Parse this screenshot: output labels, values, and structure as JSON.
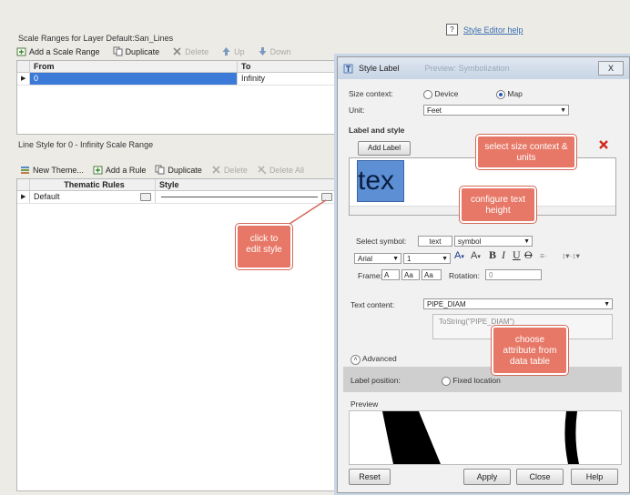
{
  "help_link": "Style Editor help",
  "scale_ranges": {
    "title": "Scale Ranges for Layer Default:San_Lines",
    "toolbar": {
      "add": "Add a Scale Range",
      "duplicate": "Duplicate",
      "delete": "Delete",
      "up": "Up",
      "down": "Down"
    },
    "columns": [
      "From",
      "To"
    ],
    "rows": [
      {
        "from": "0",
        "to": "Infinity"
      }
    ]
  },
  "line_style": {
    "title": "Line Style for 0 - Infinity Scale Range",
    "toolbar": {
      "new_theme": "New Theme...",
      "add_rule": "Add a Rule",
      "duplicate": "Duplicate",
      "delete": "Delete",
      "delete_all": "Delete All"
    },
    "columns": [
      "Thematic Rules",
      "Style"
    ],
    "rows": [
      {
        "rule": "Default",
        "style": ""
      }
    ]
  },
  "dialog": {
    "title": "Style Label",
    "title_hint": "Preview: Symbolization",
    "close": "X",
    "size_context_label": "Size context:",
    "device_label": "Device",
    "map_label": "Map",
    "unit_label": "Unit:",
    "unit_value": "Feet",
    "label_and_style": "Label and style",
    "add_label": "Add Label",
    "preview_text": "tex",
    "select_symbol_label": "Select symbol:",
    "symbol_text": "text",
    "symbol_value": "symbol",
    "font_value": "Arial",
    "size_value": "1",
    "bold": "B",
    "italic": "I",
    "underline": "U",
    "strike": "O",
    "frame_label": "Frame:",
    "frame_a": "A",
    "frame_aa": "Aa",
    "frame_box": "Aa",
    "rotation_label": "Rotation:",
    "rotation_value": "0",
    "text_content_label": "Text content:",
    "text_content_value": "PIPE_DIAM",
    "expression_value": "ToString(\"PIPE_DIAM\")",
    "advanced": "Advanced",
    "label_position_label": "Label position:",
    "fixed_location": "Fixed location",
    "preview_label": "Preview",
    "buttons": {
      "reset": "Reset",
      "apply": "Apply",
      "close": "Close",
      "help": "Help"
    }
  },
  "callouts": {
    "edit_style": "click to edit style",
    "size_units": "select size context & units",
    "text_height": "configure text height",
    "attribute": "choose attribute from data table"
  },
  "colors": {
    "callout": "#e77867",
    "selection": "#3c7ad8"
  }
}
